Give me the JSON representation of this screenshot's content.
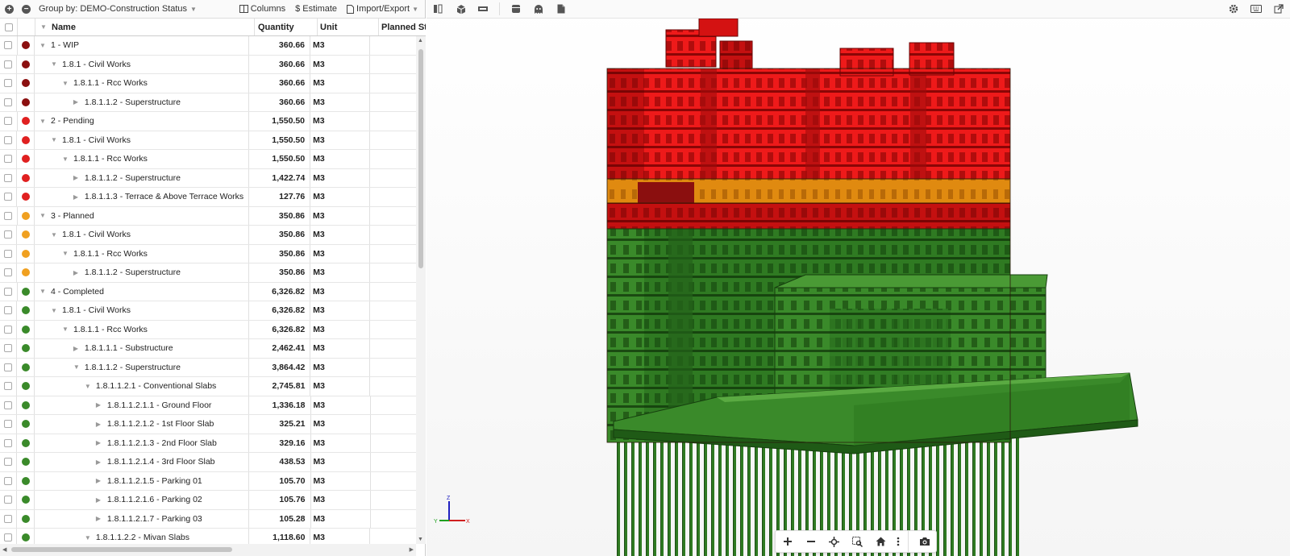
{
  "toolbar": {
    "expand_all": "+",
    "collapse_all": "−",
    "group_by_label": "Group by: DEMO-Construction Status",
    "columns_label": "Columns",
    "estimate_label": "Estimate",
    "import_export_label": "Import/Export"
  },
  "columns": {
    "name": "Name",
    "quantity": "Quantity",
    "unit": "Unit",
    "planned": "Planned St"
  },
  "status_colors": {
    "wip": "#8b0f0f",
    "pending": "#e02020",
    "planned": "#f0a020",
    "completed": "#3a8a2a"
  },
  "rows": [
    {
      "status": "wip",
      "depth": 0,
      "arrow": "down",
      "name": "1 - WIP",
      "qty": "360.66",
      "unit": "M3"
    },
    {
      "status": "wip",
      "depth": 1,
      "arrow": "down",
      "name": "1.8.1 - Civil Works",
      "qty": "360.66",
      "unit": "M3"
    },
    {
      "status": "wip",
      "depth": 2,
      "arrow": "down",
      "name": "1.8.1.1 - Rcc Works",
      "qty": "360.66",
      "unit": "M3"
    },
    {
      "status": "wip",
      "depth": 3,
      "arrow": "right",
      "name": "1.8.1.1.2 - Superstructure",
      "qty": "360.66",
      "unit": "M3"
    },
    {
      "status": "pending",
      "depth": 0,
      "arrow": "down",
      "name": "2 - Pending",
      "qty": "1,550.50",
      "unit": "M3"
    },
    {
      "status": "pending",
      "depth": 1,
      "arrow": "down",
      "name": "1.8.1 - Civil Works",
      "qty": "1,550.50",
      "unit": "M3"
    },
    {
      "status": "pending",
      "depth": 2,
      "arrow": "down",
      "name": "1.8.1.1 - Rcc Works",
      "qty": "1,550.50",
      "unit": "M3"
    },
    {
      "status": "pending",
      "depth": 3,
      "arrow": "right",
      "name": "1.8.1.1.2 - Superstructure",
      "qty": "1,422.74",
      "unit": "M3"
    },
    {
      "status": "pending",
      "depth": 3,
      "arrow": "right",
      "name": "1.8.1.1.3 - Terrace & Above Terrace Works",
      "qty": "127.76",
      "unit": "M3"
    },
    {
      "status": "planned",
      "depth": 0,
      "arrow": "down",
      "name": "3 - Planned",
      "qty": "350.86",
      "unit": "M3"
    },
    {
      "status": "planned",
      "depth": 1,
      "arrow": "down",
      "name": "1.8.1 - Civil Works",
      "qty": "350.86",
      "unit": "M3"
    },
    {
      "status": "planned",
      "depth": 2,
      "arrow": "down",
      "name": "1.8.1.1 - Rcc Works",
      "qty": "350.86",
      "unit": "M3"
    },
    {
      "status": "planned",
      "depth": 3,
      "arrow": "right",
      "name": "1.8.1.1.2 - Superstructure",
      "qty": "350.86",
      "unit": "M3"
    },
    {
      "status": "completed",
      "depth": 0,
      "arrow": "down",
      "name": "4 - Completed",
      "qty": "6,326.82",
      "unit": "M3"
    },
    {
      "status": "completed",
      "depth": 1,
      "arrow": "down",
      "name": "1.8.1 - Civil Works",
      "qty": "6,326.82",
      "unit": "M3"
    },
    {
      "status": "completed",
      "depth": 2,
      "arrow": "down",
      "name": "1.8.1.1 - Rcc Works",
      "qty": "6,326.82",
      "unit": "M3"
    },
    {
      "status": "completed",
      "depth": 3,
      "arrow": "right",
      "name": "1.8.1.1.1 - Substructure",
      "qty": "2,462.41",
      "unit": "M3"
    },
    {
      "status": "completed",
      "depth": 3,
      "arrow": "down",
      "name": "1.8.1.1.2 - Superstructure",
      "qty": "3,864.42",
      "unit": "M3"
    },
    {
      "status": "completed",
      "depth": 4,
      "arrow": "down",
      "name": "1.8.1.1.2.1 - Conventional Slabs",
      "qty": "2,745.81",
      "unit": "M3"
    },
    {
      "status": "completed",
      "depth": 5,
      "arrow": "right",
      "name": "1.8.1.1.2.1.1 - Ground Floor",
      "qty": "1,336.18",
      "unit": "M3"
    },
    {
      "status": "completed",
      "depth": 5,
      "arrow": "right",
      "name": "1.8.1.1.2.1.2 - 1st Floor Slab",
      "qty": "325.21",
      "unit": "M3"
    },
    {
      "status": "completed",
      "depth": 5,
      "arrow": "right",
      "name": "1.8.1.1.2.1.3 - 2nd Floor Slab",
      "qty": "329.16",
      "unit": "M3"
    },
    {
      "status": "completed",
      "depth": 5,
      "arrow": "right",
      "name": "1.8.1.1.2.1.4 - 3rd Floor Slab",
      "qty": "438.53",
      "unit": "M3"
    },
    {
      "status": "completed",
      "depth": 5,
      "arrow": "right",
      "name": "1.8.1.1.2.1.5 - Parking 01",
      "qty": "105.70",
      "unit": "M3"
    },
    {
      "status": "completed",
      "depth": 5,
      "arrow": "right",
      "name": "1.8.1.1.2.1.6 - Parking 02",
      "qty": "105.76",
      "unit": "M3"
    },
    {
      "status": "completed",
      "depth": 5,
      "arrow": "right",
      "name": "1.8.1.1.2.1.7 - Parking 03",
      "qty": "105.28",
      "unit": "M3"
    },
    {
      "status": "completed",
      "depth": 4,
      "arrow": "down",
      "name": "1.8.1.1.2.2 - Mivan Slabs",
      "qty": "1,118.60",
      "unit": "M3"
    }
  ],
  "viewer": {
    "axis_x": "X",
    "axis_y": "Y",
    "axis_z": "Z",
    "toolbar_icons": [
      "split-view-icon",
      "cube-icon",
      "section-icon",
      "layers-icon",
      "ghost-icon",
      "document-icon"
    ],
    "right_icons": [
      "settings-icon",
      "keyboard-icon",
      "external-link-icon"
    ],
    "nav_icons": [
      "zoom-in-icon",
      "zoom-out-icon",
      "pan-icon",
      "zoom-window-icon",
      "home-icon",
      "more-icon",
      "camera-icon"
    ]
  }
}
